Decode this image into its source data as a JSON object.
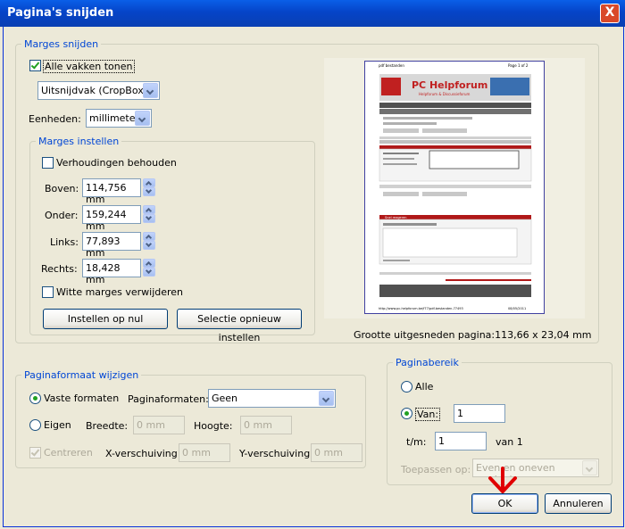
{
  "window": {
    "title": "Pagina's snijden",
    "close_label": "X"
  },
  "marges_snijden": {
    "legend": "Marges snijden",
    "show_all_label": "Alle vakken tonen",
    "show_all_checked": true,
    "box_select": "Uitsnijdvak (CropBox)",
    "units_label": "Eenheden:",
    "units_select": "millimeter",
    "marges_instellen": {
      "legend": "Marges instellen",
      "keep_ratio_label": "Verhoudingen behouden",
      "keep_ratio_checked": false,
      "top_label": "Boven:",
      "top_value": "114,756 mm",
      "bottom_label": "Onder:",
      "bottom_value": "159,244 mm",
      "left_label": "Links:",
      "left_value": "77,893 mm",
      "right_label": "Rechts:",
      "right_value": "18,428 mm",
      "remove_white_label": "Witte marges verwijderen",
      "remove_white_checked": false,
      "reset_button": "Instellen op nul",
      "reset_selection_button": "Selectie opnieuw instellen"
    },
    "preview_caption": "Grootte uitgesneden pagina:113,66 x 23,04 mm"
  },
  "paginaformaat": {
    "legend": "Paginaformaat wijzigen",
    "fixed_label": "Vaste formaten",
    "page_formats_label": "Paginaformaten:",
    "page_formats_select": "Geen",
    "custom_label": "Eigen",
    "width_label": "Breedte:",
    "width_value": "0 mm",
    "height_label": "Hoogte:",
    "height_value": "0 mm",
    "center_label": "Centreren",
    "x_offset_label": "X-verschuiving:",
    "x_offset_value": "0 mm",
    "y_offset_label": "Y-verschuiving:",
    "y_offset_value": "0 mm",
    "selected": "fixed"
  },
  "paginabereik": {
    "legend": "Paginabereik",
    "all_label": "Alle",
    "from_label": "Van:",
    "from_value": "1",
    "to_label": "t/m:",
    "to_value": "1",
    "of_label": "van 1",
    "apply_label": "Toepassen op:",
    "apply_select": "Even en oneven pagina's",
    "selected": "from"
  },
  "buttons": {
    "ok": "OK",
    "cancel": "Annuleren"
  },
  "preview_page": {
    "header_left": "pdf bestanden",
    "header_right": "Page 1 of 2",
    "forum_name": "PC Helpforum",
    "forum_tagline": "Helpforum & Discussieforum",
    "footer_left": "http://www.pc-helpforum.be/f77/pdf-bestanden-77493",
    "footer_right": "08/05/2011",
    "reply_header": "Snel reageren"
  },
  "colors": {
    "accent": "#0046D5",
    "title_bar": "#0A5FE8",
    "arrow": "#E00000",
    "forum_red": "#B01818"
  }
}
